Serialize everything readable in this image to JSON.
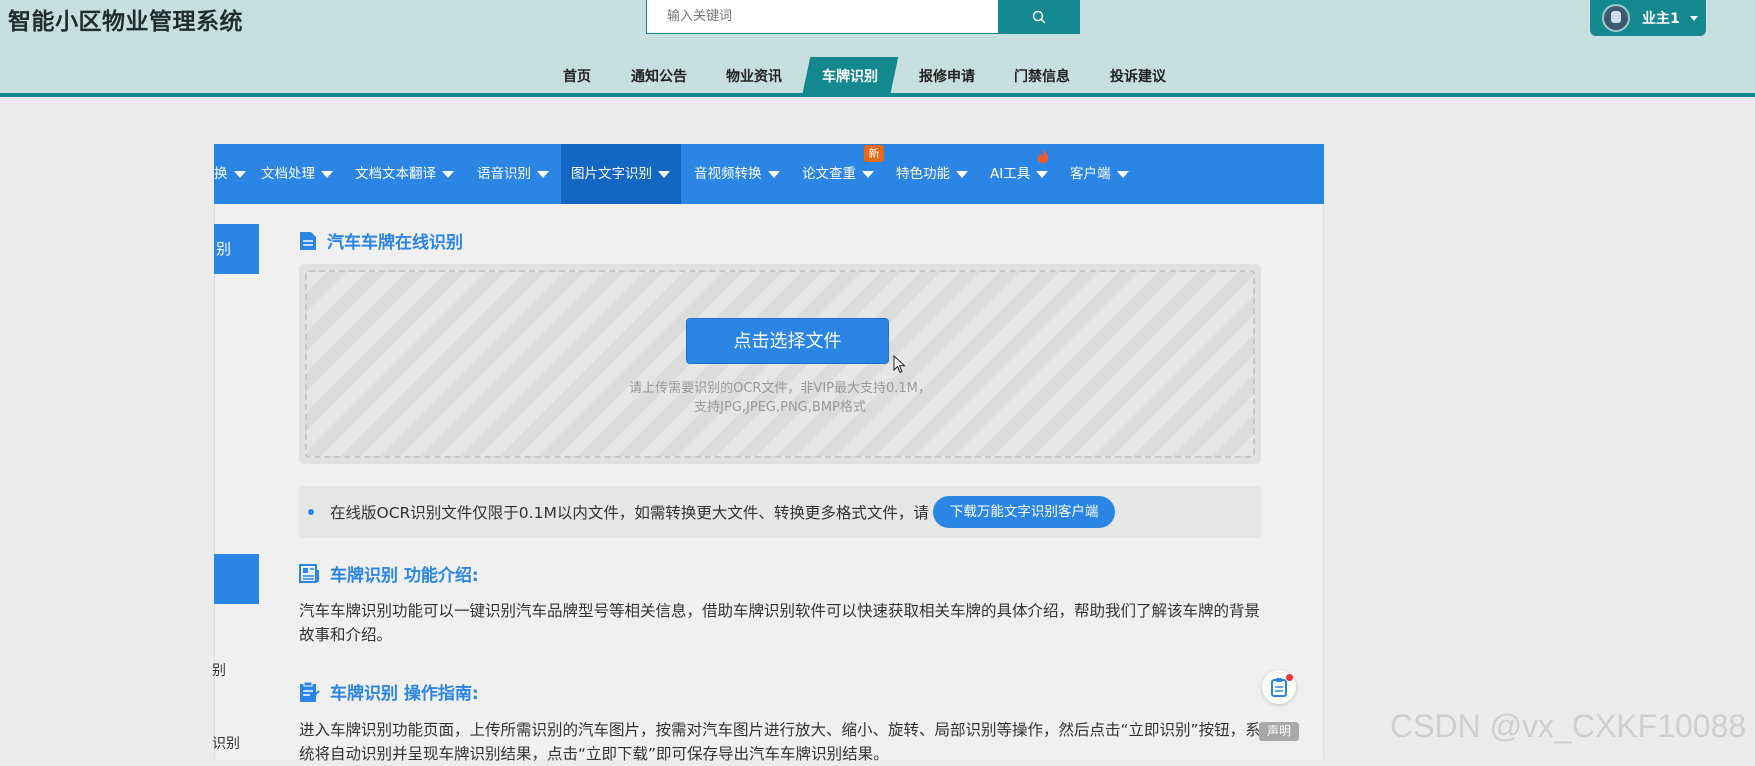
{
  "app": {
    "title": "智能小区物业管理系统"
  },
  "search": {
    "placeholder": "输入关键词",
    "icon": "search-icon"
  },
  "user": {
    "name": "业主1"
  },
  "nav": {
    "items": [
      "首页",
      "通知公告",
      "物业资讯",
      "车牌识别",
      "报修申请",
      "门禁信息",
      "投诉建议"
    ],
    "active": "车牌识别"
  },
  "menubar": {
    "items": [
      "换",
      "文档处理",
      "文档文本翻译",
      "语音识别",
      "图片文字识别",
      "音视频转换",
      "论文查重",
      "特色功能",
      "AI工具",
      "客户端"
    ],
    "selected": "图片文字识别",
    "new_badge": "新"
  },
  "sidebar": {
    "block1": "别",
    "item1": "别",
    "item2": "识别"
  },
  "main": {
    "title": "汽车车牌在线识别",
    "choose_button": "点击选择文件",
    "hint_line1": "请上传需要识别的OCR文件，非VIP最大支持0.1M，",
    "hint_line2": "支持JPG,JPEG,PNG,BMP格式",
    "notice": "在线版OCR识别文件仅限于0.1M以内文件，如需转换更大文件、转换更多格式文件，请",
    "download_button": "下载万能文字识别客户端",
    "intro_title": "车牌识别 功能介绍:",
    "intro_text": "汽车车牌识别功能可以一键识别汽车品牌型号等相关信息，借助车牌识别软件可以快速获取相关车牌的具体介绍，帮助我们了解该车牌的背景故事和介绍。",
    "guide_title": "车牌识别 操作指南:",
    "guide_text": "进入车牌识别功能页面，上传所需识别的汽车图片，按需对汽车图片进行放大、缩小、旋转、局部识别等操作，然后点击“立即识别”按钮，系统将自动识别并呈现车牌识别结果，点击“立即下载”即可保存导出汽车车牌识别结果。"
  },
  "float": {
    "declaration": "声明"
  },
  "watermark": "CSDN @vx_CXKF10088",
  "colors": {
    "teal": "#13898f",
    "blue": "#2b85e4",
    "header_bg": "#c7e0df"
  }
}
